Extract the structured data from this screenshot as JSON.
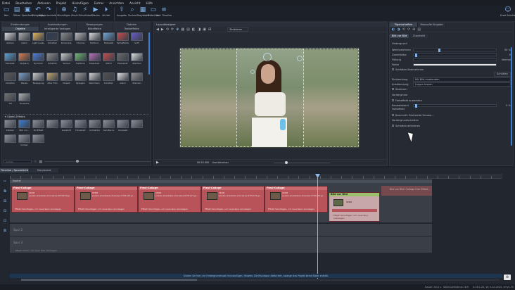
{
  "menu": [
    "Datei",
    "Bearbeiten",
    "Aktionen",
    "Projekt",
    "Hinzufügen",
    "Extras",
    "Ansichten",
    "Ansicht",
    "Hilfe"
  ],
  "toolbar": {
    "left": [
      {
        "label": "Neu",
        "icon": "new-icon"
      },
      {
        "label": "Öffnen",
        "icon": "open-icon"
      },
      {
        "label": "Speichern",
        "icon": "save-icon"
      },
      {
        "label": "Rückgängig",
        "icon": "undo-icon"
      },
      {
        "label": "Wiederherstellen",
        "icon": "redo-icon"
      }
    ],
    "mid": [
      {
        "label": "Hinzufügen",
        "icon": "add-icon"
      },
      {
        "label": "Musik",
        "icon": "music-icon"
      },
      {
        "label": "Schnellstart",
        "icon": "quickstart-icon"
      },
      {
        "label": "Starten",
        "icon": "play-icon"
      },
      {
        "label": "Ab hier",
        "icon": "play-here-icon"
      }
    ],
    "right": [
      {
        "label": "Ausgabe",
        "icon": "export-icon"
      },
      {
        "label": "Suchen",
        "icon": "search-icon"
      },
      {
        "label": "Storyboard",
        "icon": "storyboard-icon"
      },
      {
        "label": "Bildschirm",
        "icon": "screen-icon"
      },
      {
        "label": "Vert. Timeline",
        "icon": "timeline-icon"
      }
    ],
    "user": "Erste Schritte"
  },
  "toolbox": {
    "tabs_top": [
      "Einblendungen",
      "Ausblendungen",
      "Bewegungen",
      "Dateien"
    ],
    "tabs_bottom": [
      "Objekte",
      "Intelligente Vorlagen",
      "Bildeffekte",
      "Textteffekte"
    ],
    "effects": [
      "Glühen",
      "Glanz",
      "Light Leaks",
      "Schatten",
      "Kompress.",
      "Chrome",
      "Farbkorr.",
      "Farbweiß",
      "Farbeffekte",
      "SciFi",
      "Farbbalk.",
      "Displace",
      "Dynamic",
      "Schärfen",
      "Verlauf",
      "Halftone",
      "Kaleidosk.",
      "Glitch",
      "Ebenenef.",
      "Wischen",
      "Schärfen",
      "Maske",
      "Bewegung",
      "Alter Film",
      "Mosaik",
      "Spiegeln",
      "Weichzeic.",
      "Schatten",
      "Glanz",
      "Stanzen",
      "Tilt",
      "Tonwerte"
    ],
    "objekt_effekte": "Objekt-Effekte",
    "obj_items": [
      "Skizzen",
      "Bild vor...",
      "3D-Effekt",
      "",
      "Gerahmt",
      "Fotostreif.",
      "Animation",
      "Ken Burns",
      "Verpixelt",
      "",
      "",
      "Ordner",
      ""
    ],
    "search_placeholder": "Suchen"
  },
  "preview": {
    "title": "Layoutdesigner",
    "zoom_label": "Zentrieren",
    "timecode": "00:20.000",
    "live": "Live-Vorschau"
  },
  "properties": {
    "tabs": [
      "Eigenschaften",
      "Manuelle Eingabe"
    ],
    "subtabs": [
      "Bild vor Bild",
      "Zuschnitt"
    ],
    "section_hintergrund": "Hintergrund",
    "rows": [
      {
        "label": "Weichzeichnen",
        "value": "50 %"
      },
      {
        "label": "Zoomfaktor",
        "value": "0"
      },
      {
        "label": "Füllung",
        "value": "Normal"
      },
      {
        "label": "Farbe",
        "value": ""
      }
    ],
    "chk_schaetten": "Schätten übernehmen",
    "btn_schaetten": "Schätten",
    "einblendung": "Einblendung",
    "einblendung_val": "Mit Bild einblenden",
    "ausblendung": "Ausblendung",
    "ausblendung_val": "Liegen lassen",
    "chk_skalieren": "Skalieren",
    "section_vordergrund": "Vordergrund",
    "chk_farbeffekt": "Farbeffekt anwenden",
    "randabstand": "Randabstand",
    "randabstand_val": "0 %",
    "farbeffekt": "Farbeffekt",
    "chk_beschnitt": "Beschnitt: Bild bleibt Fenster...",
    "section_vorder_schatten": "Vordergrundschatten",
    "chk_schatten_akt": "Schatten aktivieren"
  },
  "timeline": {
    "tabs": [
      "Timeline / Spurenlicht",
      "Storyboard"
    ],
    "track_header": "Kapitel",
    "spur2": "Spur 2",
    "spur3": "Spur 3",
    "drop_hint": "Effekt hinzufügen, um neue Spur anzulegen",
    "clips": [
      {
        "title": "Flexi-Collage",
        "line1": "SEDB",
        "line2": "pexels-anastasia-shuraeva-6070979.jp..."
      },
      {
        "title": "Flexi-Collage",
        "line1": "SEDB",
        "line2": "pexels-anastasia-shuraeva-9701221.jp..."
      },
      {
        "title": "Flexi-Collage",
        "line1": "SEDB",
        "line2": "pexels-anastasia-shuraeva-9701221.jp..."
      },
      {
        "title": "Flexi-Collage",
        "line1": "SEDB",
        "line2": "pexels-anastasia-shuraeva-9701221.jp..."
      },
      {
        "title": "Flexi-Collage",
        "line1": "SEDB",
        "line2": "pexels-anastasia-shuraeva-9701221.jp..."
      }
    ],
    "bvb_title": "Bild vor Bild",
    "bvb_sub": "SEDB",
    "ghost": "Bild vor Bild: Collage Hier Effekt...",
    "footer_hint": "Effekt ziehen, um neue Spur anzulegen"
  },
  "status": {
    "hint": "Klicken Sie hier, um Hintergrundmusik hinzuzufügen. Hinweis: Die Musikspur bleibt leer, solange das Projekt keine Bilder enthält.",
    "dauer": "Dauer: 40,0 s",
    "ratio": "Seitenverhältnis 16:9",
    "coords": "0:16:1.20, W: 0.12.2023, cf:9/1.75"
  },
  "colors": {
    "accent": "#3a7fd5",
    "clip": "#b9535a",
    "clip_header": "#c8686f",
    "bvb": "#c7a7a9",
    "bvb_header": "#d8b8ba",
    "panel": "#252a33"
  }
}
